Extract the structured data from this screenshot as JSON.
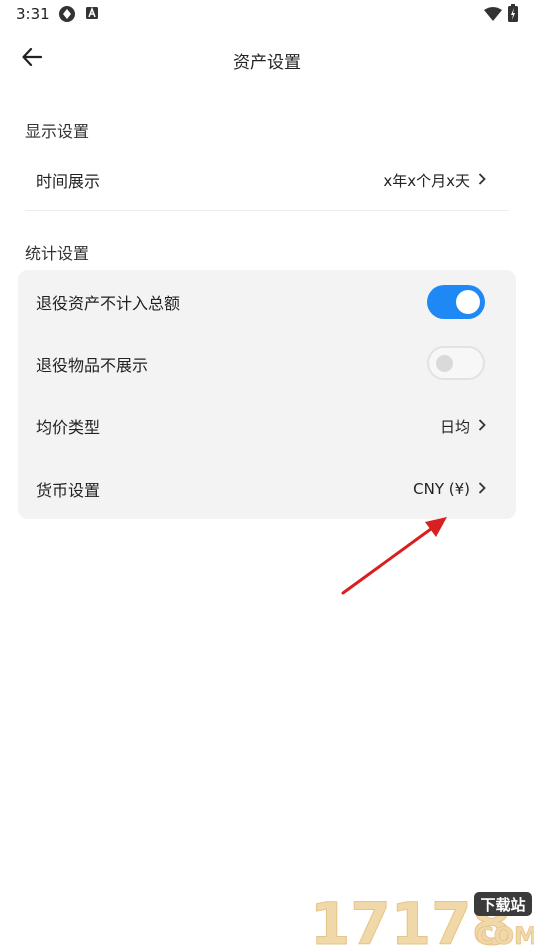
{
  "status_bar": {
    "time": "3:31"
  },
  "header": {
    "title": "资产设置"
  },
  "display_section": {
    "label": "显示设置",
    "time_display": {
      "label": "时间展示",
      "value": "x年x个月x天"
    }
  },
  "stats_section": {
    "label": "统计设置",
    "exclude_retired": {
      "label": "退役资产不计入总额",
      "checked": true
    },
    "hide_retired_items": {
      "label": "退役物品不展示",
      "checked": false
    },
    "avg_price_type": {
      "label": "均价类型",
      "value": "日均"
    },
    "currency": {
      "label": "货币设置",
      "value": "CNY (¥)"
    }
  },
  "colors": {
    "accent": "#1e88f5",
    "annotation_arrow": "#d92020"
  },
  "watermark": {
    "number": "17178",
    "badge": "下载站",
    "domain": "COM"
  }
}
